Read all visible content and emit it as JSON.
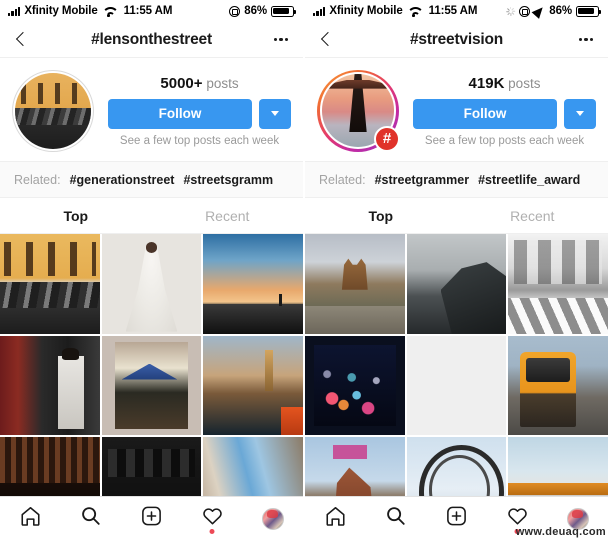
{
  "panels": [
    {
      "status": {
        "carrier": "Xfinity Mobile",
        "time": "11:55 AM",
        "battery_pct": "86%",
        "wifi_icon": "wifi-icon",
        "signal_icon": "cellular-signal-icon",
        "lock_icon": "screen-rotation-lock-icon",
        "battery_icon": "battery-icon",
        "has_spinner": false,
        "has_location": false
      },
      "header": {
        "back_icon": "chevron-left-icon",
        "title": "#lensonthestreet",
        "more_icon": "more-options-icon"
      },
      "profile": {
        "avatar_name": "hashtag-avatar",
        "has_story_ring": false,
        "has_hashtag_badge": false,
        "hashtag_badge_glyph": "#",
        "posts_count": "5000+",
        "posts_label": "posts",
        "follow_label": "Follow",
        "caret_icon": "chevron-down-icon",
        "subscription_note": "See a few top posts each week"
      },
      "related": {
        "label": "Related:",
        "tags": [
          "#generationstreet",
          "#streetsgramm"
        ]
      },
      "tabs": [
        {
          "label": "Top",
          "active": true
        },
        {
          "label": "Recent",
          "active": false
        }
      ],
      "grid": [
        {
          "name": "post-bikes-yellow-building",
          "style": "ph-bikes"
        },
        {
          "name": "post-bride-white-dress",
          "style": "ph-bride"
        },
        {
          "name": "post-sunset-pier",
          "style": "ph-sunset"
        },
        {
          "name": "post-shop-window-man",
          "style": "ph-shop"
        },
        {
          "name": "post-cafe-blue-umbrella",
          "style": "ph-cafe"
        },
        {
          "name": "post-harbor-tower",
          "style": "ph-harbor"
        },
        {
          "name": "post-dark-interior",
          "style": "ph-dark1"
        },
        {
          "name": "post-dark-enter-sign",
          "style": "ph-dark2"
        },
        {
          "name": "post-alley-sky",
          "style": "ph-alley"
        }
      ],
      "bottom_nav": [
        {
          "name": "nav-home",
          "icon": "home-icon",
          "badge": false
        },
        {
          "name": "nav-search",
          "icon": "search-icon",
          "badge": false
        },
        {
          "name": "nav-add-post",
          "icon": "plus-square-icon",
          "badge": false
        },
        {
          "name": "nav-activity",
          "icon": "heart-icon",
          "badge": true
        },
        {
          "name": "nav-profile",
          "icon": "profile-avatar-icon",
          "badge": false
        }
      ],
      "watermark": ""
    },
    {
      "status": {
        "carrier": "Xfinity Mobile",
        "time": "11:55 AM",
        "battery_pct": "86%",
        "wifi_icon": "wifi-icon",
        "signal_icon": "cellular-signal-icon",
        "lock_icon": "screen-rotation-lock-icon",
        "battery_icon": "battery-icon",
        "has_spinner": true,
        "has_location": true
      },
      "header": {
        "back_icon": "chevron-left-icon",
        "title": "#streetvision",
        "more_icon": "more-options-icon"
      },
      "profile": {
        "avatar_name": "hashtag-avatar",
        "has_story_ring": true,
        "has_hashtag_badge": true,
        "hashtag_badge_glyph": "#",
        "posts_count": "419K",
        "posts_label": "posts",
        "follow_label": "Follow",
        "caret_icon": "chevron-down-icon",
        "subscription_note": "See a few top posts each week"
      },
      "related": {
        "label": "Related:",
        "tags": [
          "#streetgrammer",
          "#streetlife_award"
        ]
      },
      "tabs": [
        {
          "label": "Top",
          "active": true
        },
        {
          "label": "Recent",
          "active": false
        }
      ],
      "grid": [
        {
          "name": "post-plaza-fountain",
          "style": "ph-plaza"
        },
        {
          "name": "post-foggy-cliff",
          "style": "ph-fog"
        },
        {
          "name": "post-bw-crosswalk",
          "style": "ph-cross"
        },
        {
          "name": "post-night-bokeh-lights",
          "style": "ph-bokeh"
        },
        {
          "name": "post-placeholder-empty",
          "style": "ph-empty"
        },
        {
          "name": "post-orange-tram",
          "style": "ph-tram"
        },
        {
          "name": "post-horse-statue",
          "style": "ph-horse"
        },
        {
          "name": "post-ferris-wheel",
          "style": "ph-wheel"
        },
        {
          "name": "post-tram-street",
          "style": "ph-tram2"
        }
      ],
      "bottom_nav": [
        {
          "name": "nav-home",
          "icon": "home-icon",
          "badge": false
        },
        {
          "name": "nav-search",
          "icon": "search-icon",
          "badge": false
        },
        {
          "name": "nav-add-post",
          "icon": "plus-square-icon",
          "badge": false
        },
        {
          "name": "nav-activity",
          "icon": "heart-icon",
          "badge": true
        },
        {
          "name": "nav-profile",
          "icon": "profile-avatar-icon",
          "badge": false
        }
      ],
      "watermark": "www.deuaq.com"
    }
  ],
  "colors": {
    "accent_blue": "#3897f0",
    "notification_red": "#ed4956",
    "hashtag_badge_red": "#e0322a",
    "muted_text": "#8e8e8e",
    "related_bg": "#fafafa"
  }
}
